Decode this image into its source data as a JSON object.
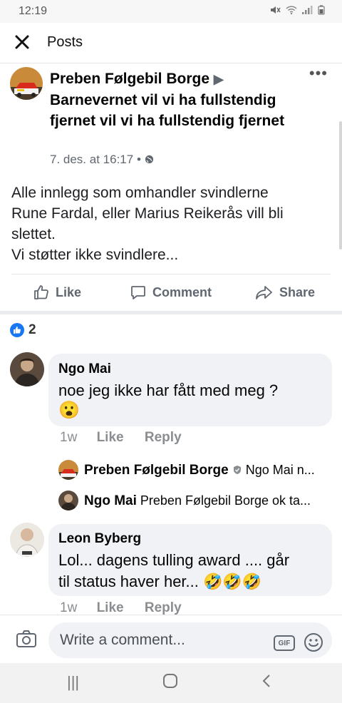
{
  "status_bar": {
    "time": "12:19",
    "icons": [
      "mute-icon",
      "wifi-icon",
      "signal-icon",
      "battery-icon"
    ]
  },
  "top_bar": {
    "title": "Posts",
    "close_icon": "close-icon"
  },
  "post": {
    "author": "Preben Følgebil Borge",
    "arrow": "▶",
    "target": "Barnevernet vil vi ha fullstendig fjernet vil vi ha fullstendig fjernet",
    "timestamp": "7. des. at 16:17",
    "separator": "•",
    "body": [
      "Alle innlegg som omhandler svindlerne",
      "Rune Fardal, eller Marius Reikerås vill bli",
      "slettet.",
      "Vi støtter ikke svindlere..."
    ],
    "actions": {
      "like": "Like",
      "comment": "Comment",
      "share": "Share"
    }
  },
  "reactions": {
    "count": "2"
  },
  "comments": [
    {
      "name": "Ngo Mai",
      "text": "noe jeg ikke har fått med meg ?",
      "emoji": "😮",
      "time": "1w",
      "like": "Like",
      "reply": "Reply"
    },
    {
      "name": "Leon Byberg",
      "text_line1": "Lol... dagens tulling award .... går",
      "text_line2": "til status haver her...",
      "emoji": "🤣🤣🤣",
      "time": "1w",
      "like": "Like",
      "reply": "Reply"
    }
  ],
  "replies": [
    {
      "name": "Preben Følgebil Borge",
      "text": "Ngo Mai n..."
    },
    {
      "name": "Ngo Mai",
      "text": "Preben Følgebil Borge ok ta..."
    }
  ],
  "composer": {
    "placeholder": "Write a comment...",
    "gif": "GIF"
  },
  "nav": {
    "recents": "|||",
    "home": "○",
    "back": "<"
  }
}
